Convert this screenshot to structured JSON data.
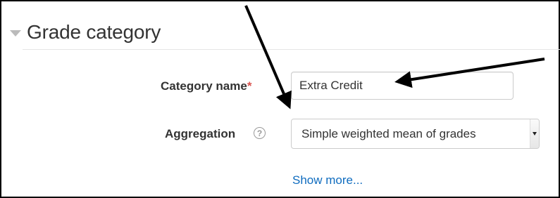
{
  "section": {
    "title": "Grade category",
    "collapse_icon": "triangle-down-icon"
  },
  "fields": {
    "category_name": {
      "label": "Category name",
      "required_mark": "*",
      "value": "Extra Credit"
    },
    "aggregation": {
      "label": "Aggregation",
      "help_icon": "?",
      "selected": "Simple weighted mean of grades"
    }
  },
  "show_more": "Show more...",
  "colors": {
    "link": "#0f6cbf",
    "required": "#d9534f",
    "annotation_arrow": "#000000"
  }
}
